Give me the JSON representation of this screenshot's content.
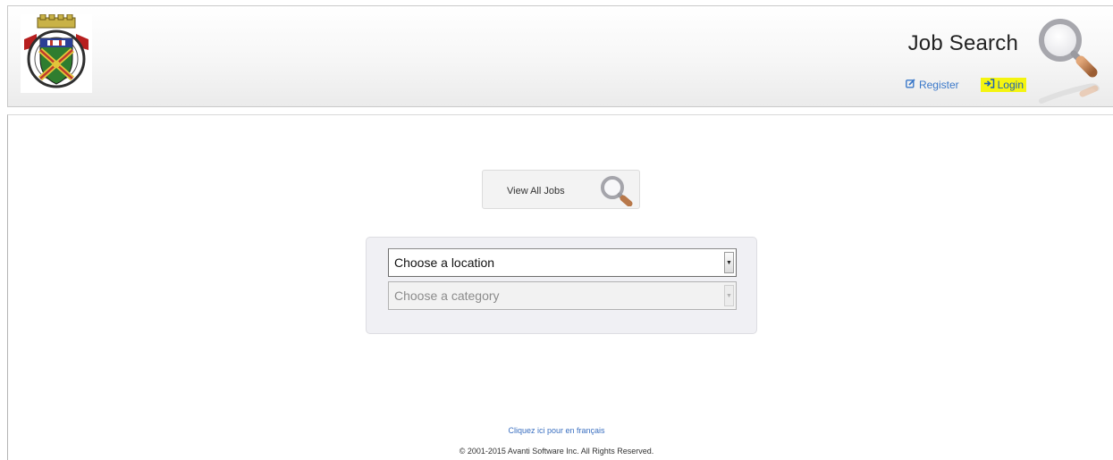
{
  "header": {
    "title": "Job Search",
    "register_label": "Register",
    "login_label": "Login",
    "icons": {
      "crest": "municipal-crest-logo",
      "search": "magnifier-icon",
      "register": "edit-icon",
      "login": "sign-in-icon"
    }
  },
  "main": {
    "view_all_label": "View All Jobs",
    "location_select": {
      "selected": "Choose a location",
      "enabled": true
    },
    "category_select": {
      "selected": "Choose a category",
      "enabled": false
    }
  },
  "footer": {
    "french_link": "Cliquez ici pour en français",
    "copyright": "© 2001-2015 Avanti Software Inc. All Rights Reserved."
  },
  "colors": {
    "link_blue": "#3a78c9",
    "login_highlight": "#f4f410",
    "panel_background": "#f0f0f4"
  }
}
